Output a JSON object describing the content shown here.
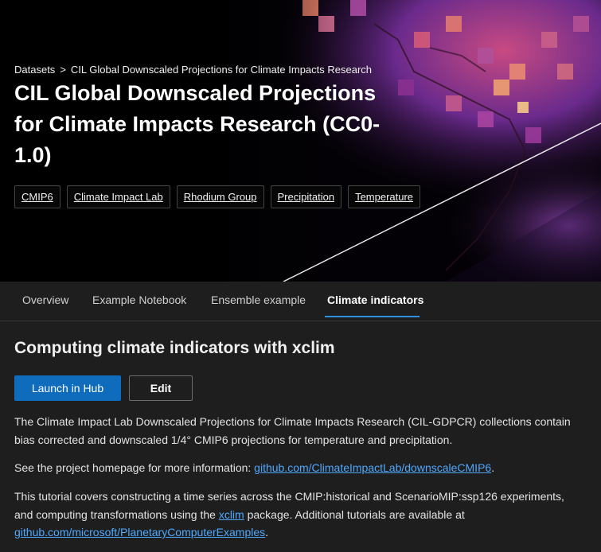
{
  "breadcrumb": {
    "root": "Datasets",
    "separator": ">",
    "current": "CIL Global Downscaled Projections for Climate Impacts Research"
  },
  "hero": {
    "title": "CIL Global Downscaled Projections for Climate Impacts Research (CC0-1.0)",
    "tags": [
      "CMIP6",
      "Climate Impact Lab",
      "Rhodium Group",
      "Precipitation",
      "Temperature"
    ]
  },
  "tabs": [
    {
      "label": "Overview",
      "active": false
    },
    {
      "label": "Example Notebook",
      "active": false
    },
    {
      "label": "Ensemble example",
      "active": false
    },
    {
      "label": "Climate indicators",
      "active": true
    }
  ],
  "content": {
    "heading": "Computing climate indicators with xclim",
    "launch_label": "Launch in Hub",
    "edit_label": "Edit",
    "p1": "The Climate Impact Lab Downscaled Projections for Climate Impacts Research (CIL-GDPCR) collections contain bias corrected and downscaled 1/4° CMIP6 projections for temperature and precipitation.",
    "p2_prefix": "See the project homepage for more information: ",
    "p2_link": "github.com/ClimateImpactLab/downscaleCMIP6",
    "p2_suffix": ".",
    "p3_prefix": "This tutorial covers constructing a time series across the CMIP:historical and ScenarioMIP:ssp126 experiments, and computing transformations using the ",
    "p3_link1": "xclim",
    "p3_middle": " package. Additional tutorials are available at ",
    "p3_link2": "github.com/microsoft/PlanetaryComputerExamples",
    "p3_suffix": "."
  },
  "colors": {
    "accent": "#0f6cbd",
    "link": "#4fa8ff",
    "tab_underline": "#2f8fe0",
    "background": "#1e1e1e"
  }
}
